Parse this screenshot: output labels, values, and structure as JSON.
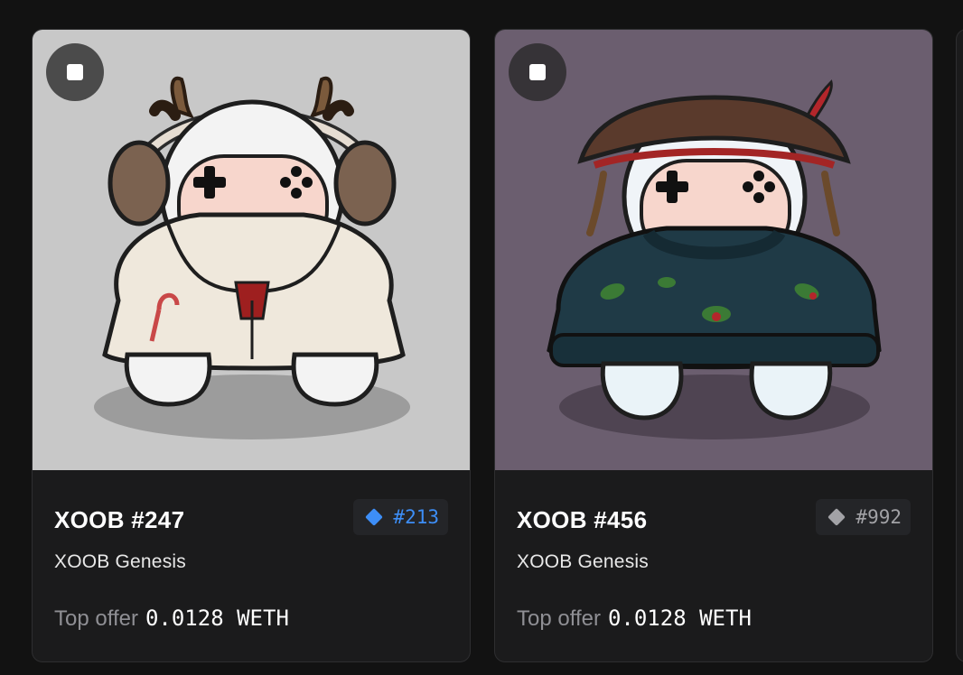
{
  "cards": [
    {
      "title": "XOOB #247",
      "collection": "XOOB Genesis",
      "rank": "#213",
      "rank_color": "#3d8ef7",
      "offer_label": "Top offer",
      "offer_value": "0.0128 WETH",
      "background": "#c8c8c8",
      "image": "xoob-yeti-antlers-earmuffs-jacket"
    },
    {
      "title": "XOOB #456",
      "collection": "XOOB Genesis",
      "rank": "#992",
      "rank_color": "#a2a2a6",
      "offer_label": "Top offer",
      "offer_value": "0.0128 WETH",
      "background": "#6b5e6f",
      "image": "xoob-yeti-pirate-hat-holiday-sweater"
    }
  ],
  "icons": {
    "select": "checkbox-icon",
    "rank": "diamond-icon"
  }
}
